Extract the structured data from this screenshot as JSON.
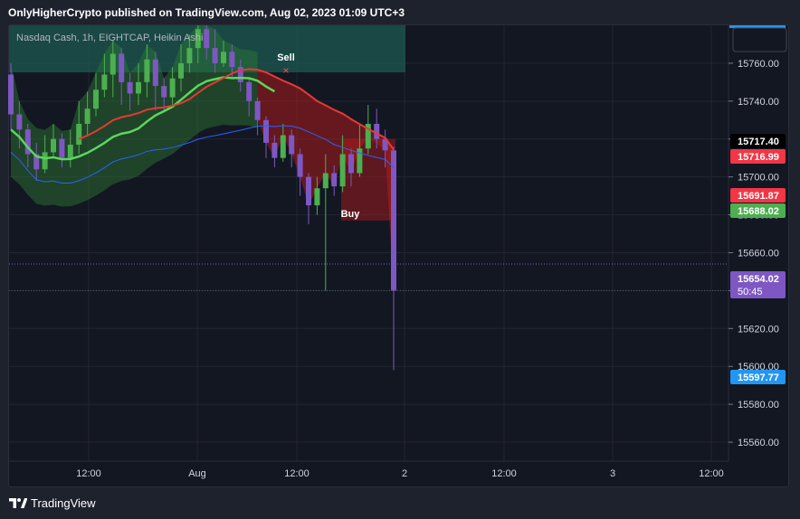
{
  "header": {
    "title": "OnlyHigherCrypto published on TradingView.com, Aug 02, 2023 01:09 UTC+3"
  },
  "legend": {
    "text": "Nasdaq Cash, 1h, EIGHTCAP, Heikin Ashi"
  },
  "footer": {
    "brand": "TradingView"
  },
  "colors": {
    "background": "#131722",
    "up": "#4caf50",
    "down": "#7e57c2",
    "cloud_top": "#1c5a52",
    "green_band": "#2e7d32",
    "red_band": "#b71c1c",
    "sma_green": "#5cd65c",
    "ema_red": "#e53935",
    "ema_blue": "#2962ff"
  },
  "chart_data": {
    "type": "candlestick",
    "ylim": [
      15550,
      15780
    ],
    "y_ticks": [
      "15760.00",
      "15740.00",
      "15720.00",
      "15700.00",
      "15680.00",
      "15660.00",
      "15640.00",
      "15620.00",
      "15600.00",
      "15580.00",
      "15560.00"
    ],
    "x_ticks": [
      "12:00",
      "Aug",
      "12:00",
      "2",
      "12:00",
      "3",
      "12:00"
    ],
    "annotations": [
      "Sell",
      "Buy"
    ],
    "price_labels": [
      {
        "text": "15717.40",
        "value": 15717.4,
        "bg": "#000000",
        "fg": "#ffffff"
      },
      {
        "text": "15716.99",
        "value": 15716.99,
        "bg": "#f23645",
        "fg": "#ffffff"
      },
      {
        "text": "15691.87",
        "value": 15691.87,
        "bg": "#f23645",
        "fg": "#ffffff"
      },
      {
        "text": "15688.02",
        "value": 15688.02,
        "bg": "#4caf50",
        "fg": "#ffffff"
      },
      {
        "text": "15654.02",
        "sub": "50:45",
        "value": 15654.02,
        "bg": "#7e57c2",
        "fg": "#ffffff"
      },
      {
        "text": "15597.77",
        "value": 15597.77,
        "bg": "#2196f3",
        "fg": "#ffffff"
      }
    ],
    "candles": [
      {
        "o": 15754,
        "c": 15733,
        "h": 15760,
        "l": 15725
      },
      {
        "o": 15733,
        "c": 15725,
        "h": 15740,
        "l": 15715
      },
      {
        "o": 15725,
        "c": 15712,
        "h": 15728,
        "l": 15705
      },
      {
        "o": 15712,
        "c": 15704,
        "h": 15718,
        "l": 15698
      },
      {
        "o": 15704,
        "c": 15713,
        "h": 15722,
        "l": 15702
      },
      {
        "o": 15713,
        "c": 15720,
        "h": 15728,
        "l": 15710
      },
      {
        "o": 15720,
        "c": 15710,
        "h": 15723,
        "l": 15705
      },
      {
        "o": 15710,
        "c": 15717,
        "h": 15725,
        "l": 15705
      },
      {
        "o": 15717,
        "c": 15728,
        "h": 15740,
        "l": 15712
      },
      {
        "o": 15728,
        "c": 15736,
        "h": 15745,
        "l": 15722
      },
      {
        "o": 15736,
        "c": 15746,
        "h": 15755,
        "l": 15732
      },
      {
        "o": 15746,
        "c": 15754,
        "h": 15765,
        "l": 15742
      },
      {
        "o": 15754,
        "c": 15765,
        "h": 15772,
        "l": 15742
      },
      {
        "o": 15765,
        "c": 15750,
        "h": 15768,
        "l": 15738
      },
      {
        "o": 15750,
        "c": 15744,
        "h": 15755,
        "l": 15735
      },
      {
        "o": 15744,
        "c": 15750,
        "h": 15760,
        "l": 15738
      },
      {
        "o": 15750,
        "c": 15762,
        "h": 15770,
        "l": 15742
      },
      {
        "o": 15762,
        "c": 15748,
        "h": 15766,
        "l": 15735
      },
      {
        "o": 15748,
        "c": 15742,
        "h": 15752,
        "l": 15735
      },
      {
        "o": 15742,
        "c": 15752,
        "h": 15758,
        "l": 15738
      },
      {
        "o": 15752,
        "c": 15760,
        "h": 15770,
        "l": 15745
      },
      {
        "o": 15760,
        "c": 15768,
        "h": 15775,
        "l": 15755
      },
      {
        "o": 15768,
        "c": 15778,
        "h": 15780,
        "l": 15760
      },
      {
        "o": 15778,
        "c": 15768,
        "h": 15780,
        "l": 15762
      },
      {
        "o": 15768,
        "c": 15760,
        "h": 15778,
        "l": 15755
      },
      {
        "o": 15760,
        "c": 15766,
        "h": 15772,
        "l": 15758
      },
      {
        "o": 15766,
        "c": 15758,
        "h": 15770,
        "l": 15752
      },
      {
        "o": 15758,
        "c": 15750,
        "h": 15762,
        "l": 15745
      },
      {
        "o": 15750,
        "c": 15740,
        "h": 15752,
        "l": 15732
      },
      {
        "o": 15740,
        "c": 15730,
        "h": 15742,
        "l": 15722
      },
      {
        "o": 15730,
        "c": 15718,
        "h": 15732,
        "l": 15710
      },
      {
        "o": 15718,
        "c": 15710,
        "h": 15722,
        "l": 15705
      },
      {
        "o": 15710,
        "c": 15722,
        "h": 15728,
        "l": 15708
      },
      {
        "o": 15722,
        "c": 15712,
        "h": 15725,
        "l": 15705
      },
      {
        "o": 15712,
        "c": 15700,
        "h": 15715,
        "l": 15690
      },
      {
        "o": 15700,
        "c": 15685,
        "h": 15702,
        "l": 15675
      },
      {
        "o": 15685,
        "c": 15694,
        "h": 15700,
        "l": 15680
      },
      {
        "o": 15694,
        "c": 15702,
        "h": 15712,
        "l": 15640
      },
      {
        "o": 15702,
        "c": 15695,
        "h": 15706,
        "l": 15690
      },
      {
        "o": 15695,
        "c": 15712,
        "h": 15722,
        "l": 15692
      },
      {
        "o": 15712,
        "c": 15702,
        "h": 15715,
        "l": 15695
      },
      {
        "o": 15702,
        "c": 15715,
        "h": 15728,
        "l": 15700
      },
      {
        "o": 15715,
        "c": 15728,
        "h": 15738,
        "l": 15712
      },
      {
        "o": 15728,
        "c": 15720,
        "h": 15736,
        "l": 15715
      },
      {
        "o": 15720,
        "c": 15714,
        "h": 15725,
        "l": 15705
      },
      {
        "o": 15714,
        "c": 15640,
        "h": 15716,
        "l": 15598
      }
    ]
  }
}
